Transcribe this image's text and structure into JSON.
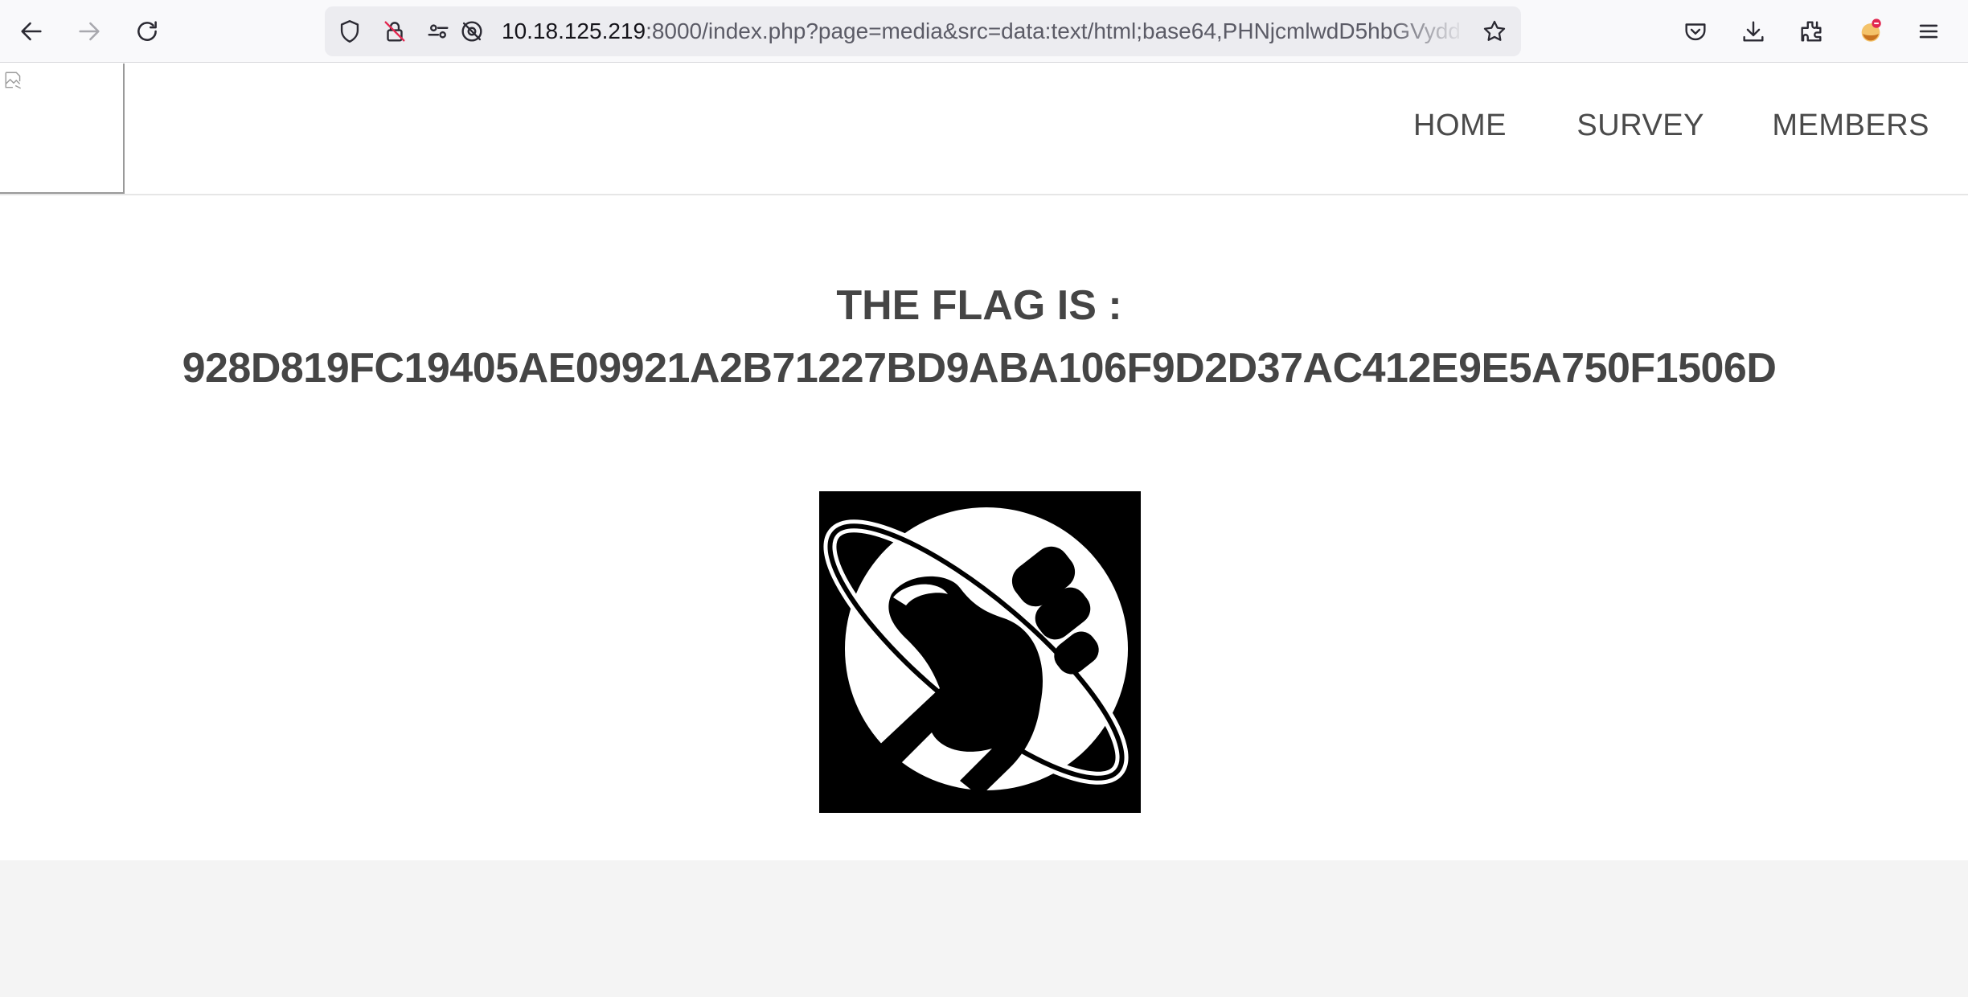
{
  "browser": {
    "url_host": "10.18.125.219",
    "url_rest": ":8000/index.php?page=media&src=data:text/html;base64,PHNjcmlwdD5hbGVydd"
  },
  "header": {
    "nav": [
      {
        "label": "HOME"
      },
      {
        "label": "SURVEY"
      },
      {
        "label": "MEMBERS"
      }
    ]
  },
  "main": {
    "flag_title": "THE FLAG IS :",
    "flag_value": "928D819FC19405AE09921A2B71227BD9ABA106F9D2D37AC412E9E5A750F1506D"
  },
  "icons": {
    "back": "arrow-left-icon",
    "forward": "arrow-right-icon",
    "reload": "reload-icon",
    "tracking": "shield-icon",
    "insecure": "insecure-lock-icon",
    "permissions": "permissions-icon",
    "camera_blocked": "camera-blocked-icon",
    "bookmark": "star-icon",
    "pocket": "pocket-icon",
    "downloads": "download-icon",
    "extensions": "puzzle-icon",
    "account": "avatar-icon",
    "menu": "hamburger-icon",
    "broken_image": "broken-image-icon",
    "emblem": "thumbs-up-planet-emblem"
  }
}
